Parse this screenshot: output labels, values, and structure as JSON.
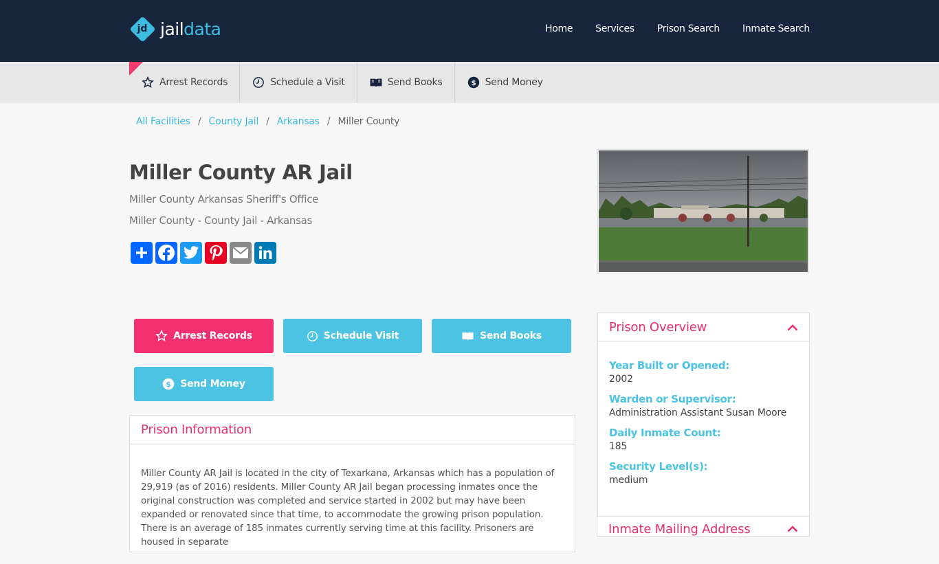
{
  "brand": {
    "mark": "jd",
    "name_left": "jail",
    "name_right": "data"
  },
  "nav": [
    {
      "label": "Home"
    },
    {
      "label": "Services"
    },
    {
      "label": "Prison Search"
    },
    {
      "label": "Inmate Search"
    }
  ],
  "subnav": [
    {
      "label": "Arrest Records",
      "icon": "star-icon"
    },
    {
      "label": "Schedule a Visit",
      "icon": "clock-icon"
    },
    {
      "label": "Send Books",
      "icon": "book-icon"
    },
    {
      "label": "Send Money",
      "icon": "dollar-icon"
    }
  ],
  "breadcrumb": {
    "items": [
      "All Facilities",
      "County Jail",
      "Arkansas"
    ],
    "current": "Miller County",
    "separator": "/"
  },
  "facility": {
    "title": "Miller County AR Jail",
    "subtitle1": "Miller County Arkansas Sheriff's Office",
    "subtitle2": "Miller County - County Jail - Arkansas"
  },
  "share": [
    {
      "name": "share-add",
      "color": "#0166ff"
    },
    {
      "name": "facebook",
      "color": "#0866ff"
    },
    {
      "name": "twitter",
      "color": "#1d9bf0"
    },
    {
      "name": "pinterest",
      "color": "#e60023"
    },
    {
      "name": "email",
      "color": "#888888"
    },
    {
      "name": "linkedin",
      "color": "#007bb5"
    }
  ],
  "actions": {
    "arrest": "Arrest Records",
    "visit": "Schedule Visit",
    "books": "Send Books",
    "money": "Send Money"
  },
  "prison_info": {
    "heading": "Prison Information",
    "body": "Miller County AR Jail is located in the city of Texarkana, Arkansas which has a population of 29,919 (as of 2016) residents. Miller County AR Jail began processing inmates once the original construction was completed and service started in 2002 but may have been expanded or renovated since that time, to accommodate the growing prison population. There is an average of 185 inmates currently serving time at this facility. Prisoners are housed in separate"
  },
  "overview": {
    "heading": "Prison Overview",
    "fields": [
      {
        "label": "Year Built or Opened:",
        "value": "2002"
      },
      {
        "label": "Warden or Supervisor:",
        "value": "Administration Assistant Susan Moore"
      },
      {
        "label": "Daily Inmate Count:",
        "value": "185"
      },
      {
        "label": "Security Level(s):",
        "value": "medium"
      }
    ],
    "next_heading": "Inmate Mailing Address"
  },
  "colors": {
    "navy": "#17253d",
    "accent_blue": "#4cc3e3",
    "accent_pink": "#f33170"
  }
}
